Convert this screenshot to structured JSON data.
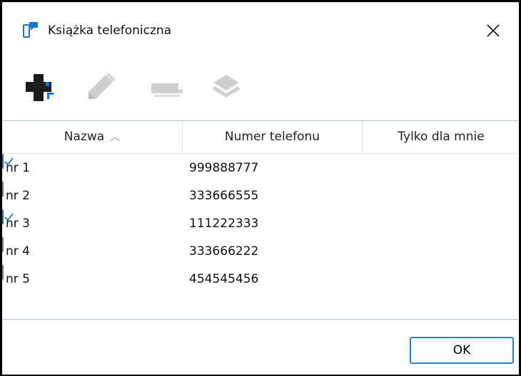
{
  "window": {
    "title": "Książka telefoniczna"
  },
  "toolbar": {
    "buttons": [
      {
        "icon": "add-contact-icon",
        "enabled": true
      },
      {
        "icon": "pencil-icon",
        "enabled": false
      },
      {
        "icon": "rename-icon",
        "enabled": false
      },
      {
        "icon": "layers-icon",
        "enabled": false
      }
    ]
  },
  "table": {
    "columns": [
      "Nazwa",
      "Numer telefonu",
      "Tylko dla mnie"
    ],
    "sort": {
      "column": "Nazwa",
      "direction": "ascending",
      "icon": "sort-ascending-icon"
    },
    "rows": [
      {
        "name": "nr 1",
        "number": "999888777",
        "only_me": true
      },
      {
        "name": "nr 2",
        "number": "333666555",
        "only_me": false
      },
      {
        "name": "nr 3",
        "number": "111222333",
        "only_me": true
      },
      {
        "name": "nr 4",
        "number": "333666222",
        "only_me": false
      },
      {
        "name": "nr 5",
        "number": "454545456",
        "only_me": false
      }
    ]
  },
  "footer": {
    "ok_label": "OK"
  },
  "colors": {
    "accent": "#1a73d1",
    "icon_dark": "#1b1b1b",
    "icon_disabled": "#cfcfcf"
  }
}
